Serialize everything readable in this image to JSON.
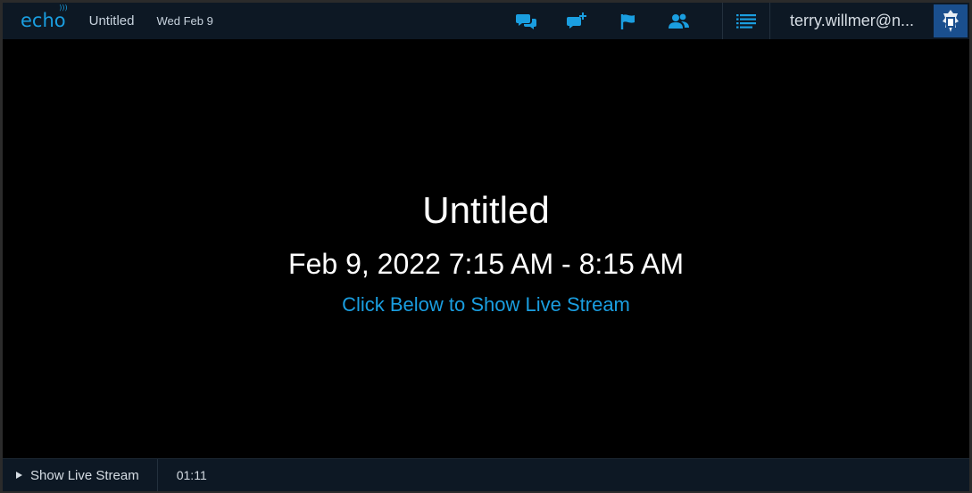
{
  "header": {
    "logo": "echo",
    "title": "Untitled",
    "date": "Wed Feb 9",
    "user": "terry.willmer@n..."
  },
  "main": {
    "title": "Untitled",
    "time": "Feb 9, 2022 7:15 AM - 8:15 AM",
    "link": "Click Below to Show Live Stream"
  },
  "footer": {
    "play_label": "Show Live Stream",
    "timer": "01:11"
  },
  "icons": [
    "chat-icon",
    "add-question-icon",
    "flag-icon",
    "people-icon",
    "list-icon",
    "crest-icon"
  ],
  "colors": {
    "accent": "#1a9ee0",
    "bar_bg": "#0d1824",
    "crest_bg": "#1a4f8e"
  }
}
